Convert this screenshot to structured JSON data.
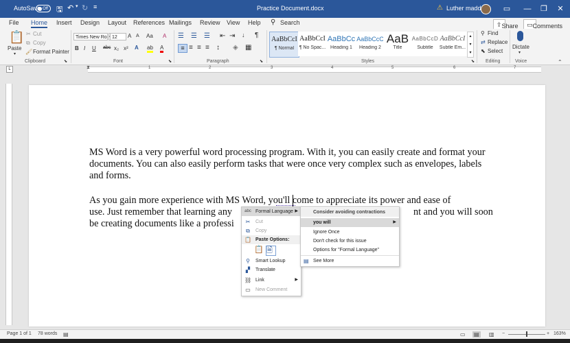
{
  "titlebar": {
    "autosave_label": "AutoSave",
    "autosave_state": "Off",
    "doc_title": "Practice Document.docx",
    "user_name": "Luther maddy",
    "accent": "#2b579a"
  },
  "tabs": [
    "File",
    "Home",
    "Insert",
    "Design",
    "Layout",
    "References",
    "Mailings",
    "Review",
    "View",
    "Help"
  ],
  "active_tab": "Home",
  "search_label": "Search",
  "share_label": "Share",
  "comments_label": "Comments",
  "ribbon": {
    "clipboard": {
      "paste": "Paste",
      "cut": "Cut",
      "copy": "Copy",
      "format_painter": "Format Painter",
      "label": "Clipboard"
    },
    "font": {
      "name": "Times New Ro",
      "size": "12",
      "label": "Font",
      "grow": "A",
      "shrink": "A",
      "case": "Aa",
      "clear": "A",
      "bold": "B",
      "italic": "I",
      "underline": "U",
      "strike": "abc",
      "sub": "x₂",
      "sup": "x²",
      "effects": "A",
      "highlight": "ab",
      "color": "A"
    },
    "paragraph": {
      "label": "Paragraph",
      "pilcrow": "¶"
    },
    "styles": {
      "label": "Styles",
      "items": [
        {
          "sample": "AaBbCcI",
          "name": "¶ Normal"
        },
        {
          "sample": "AaBbCcI",
          "name": "¶ No Spac..."
        },
        {
          "sample": "AaBbCc",
          "name": "Heading 1"
        },
        {
          "sample": "AaBbCcC",
          "name": "Heading 2"
        },
        {
          "sample": "AaB",
          "name": "Title"
        },
        {
          "sample": "AaBbCcD",
          "name": "Subtitle"
        },
        {
          "sample": "AaBbCcI",
          "name": "Subtle Em..."
        }
      ]
    },
    "editing": {
      "find": "Find",
      "replace": "Replace",
      "select": "Select",
      "label": "Editing"
    },
    "voice": {
      "dictate": "Dictate",
      "label": "Voice"
    }
  },
  "ruler_numbers": [
    "1",
    "2",
    "3",
    "4",
    "5",
    "6",
    "7"
  ],
  "document": {
    "para1": "MS Word is a very powerful word processing program.  With it, you can easily create and format your documents.  You can also easily perform tasks that were once very complex such as envelopes, labels and forms.",
    "para2_line1": "As you gain more experience with MS Word, you'll come to appreciate its power and ease of",
    "para2_line2a": "use.  Just remember that learning any",
    "para2_line2b": "nt and you will soon",
    "para2_line3": "be creating documents like a professi"
  },
  "context_menu": {
    "formal_language": "Formal Language",
    "cut": "Cut",
    "copy": "Copy",
    "paste_options": "Paste Options:",
    "smart_lookup": "Smart Lookup",
    "translate": "Translate",
    "link": "Link",
    "new_comment": "New Comment"
  },
  "submenu": {
    "header": "Consider avoiding contractions",
    "suggestion": "you will",
    "ignore_once": "Ignore Once",
    "dont_check": "Don't check for this issue",
    "options": "Options for \"Formal Language\"",
    "see_more": "See More"
  },
  "status": {
    "page": "Page 1 of 1",
    "words": "78 words",
    "zoom": "163%"
  }
}
